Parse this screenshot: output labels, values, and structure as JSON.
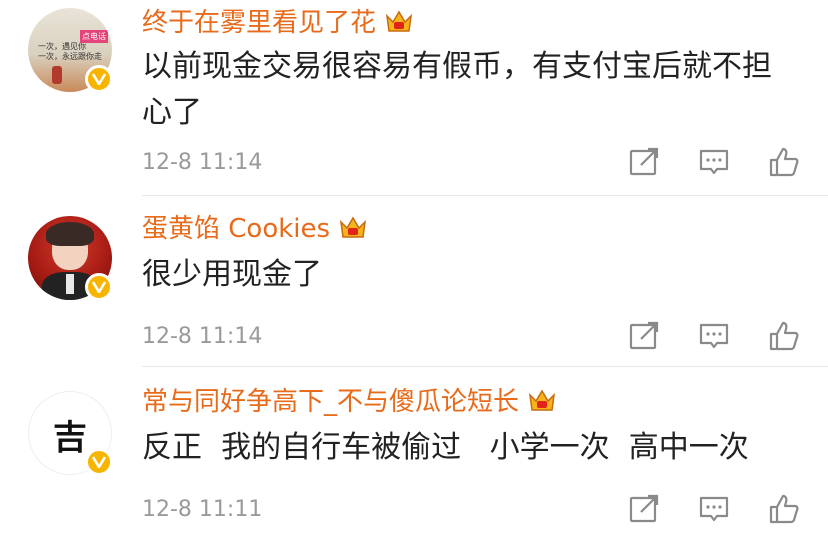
{
  "comments": [
    {
      "username": "终于在雾里看见了花",
      "text": "以前现金交易很容易有假币，有支付宝后就不担心了",
      "time": "12-8 11:14",
      "avatar_text_lines": [
        "一次，遇见你",
        "一次，永远跟你走"
      ],
      "avatar_tag": "点电话"
    },
    {
      "username": "蛋黄馅 Cookies",
      "text": "很少用现金了",
      "time": "12-8 11:14"
    },
    {
      "username": "常与同好争高下_不与傻瓜论短长",
      "text": "反正  我的自行车被偷过   小学一次  高中一次",
      "time": "12-8 11:11",
      "avatar_char": "吉"
    }
  ],
  "icons": {
    "share": "share-icon",
    "comment": "comment-icon",
    "like": "like-icon",
    "verified": "verified-icon",
    "vip": "vip-crown-icon"
  },
  "colors": {
    "username": "#e86b1b",
    "badge": "#f7b500",
    "time": "#9a9a9a"
  }
}
